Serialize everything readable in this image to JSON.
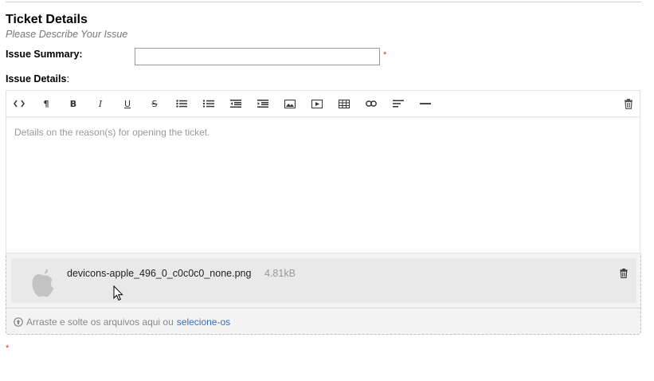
{
  "section": {
    "title": "Ticket Details",
    "subtitle": "Please Describe Your Issue"
  },
  "form": {
    "summary_label": "Issue Summary:",
    "summary_value": "",
    "required_mark": "*",
    "details_label": "Issue Details",
    "details_colon": ":",
    "details_placeholder": "Details on the reason(s) for opening the ticket."
  },
  "toolbar": {
    "buttons": [
      "code-view",
      "paragraph",
      "bold",
      "italic",
      "underline",
      "strikethrough",
      "unordered-list",
      "ordered-list",
      "outdent",
      "indent",
      "image",
      "video",
      "table",
      "link",
      "align",
      "horizontal-rule",
      "delete"
    ]
  },
  "attachment": {
    "file_name": "devicons-apple_496_0_c0c0c0_none.png",
    "file_size": "4.81kB",
    "drop_text": "Arraste e solte os arquivos aqui ou",
    "drop_link": "selecione-os"
  },
  "colors": {
    "link": "#3c6eb4",
    "required": "#dd3333",
    "placeholder": "#999999"
  }
}
